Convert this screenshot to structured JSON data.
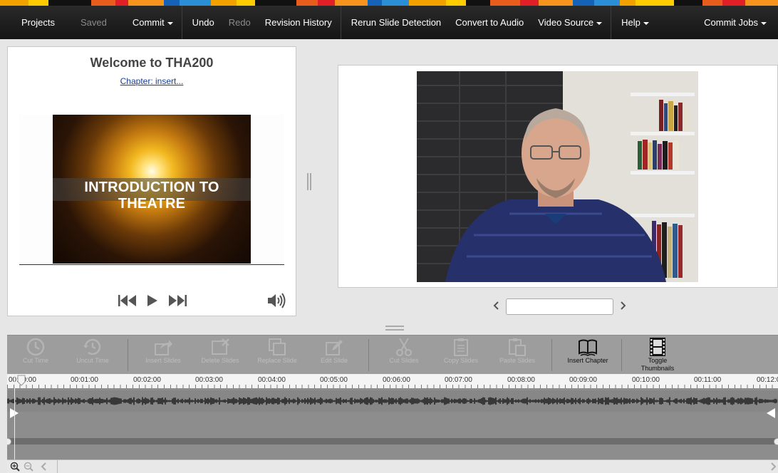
{
  "colors": {
    "navbar_bg": "#1c1c1c",
    "stripe": [
      "#f2a100",
      "#e85c1c",
      "#1463b8",
      "#ffcc00",
      "#e01f27",
      "#2a8fd6",
      "#111111",
      "#f7941d"
    ]
  },
  "navbar": {
    "items": [
      {
        "label": "Projects",
        "disabled": false,
        "caret": false
      },
      {
        "label": "Saved",
        "disabled": true,
        "caret": false
      },
      {
        "label": "Commit",
        "disabled": false,
        "caret": true
      },
      {
        "label": "Undo",
        "disabled": false,
        "caret": false
      },
      {
        "label": "Redo",
        "disabled": true,
        "caret": false
      },
      {
        "label": "Revision History",
        "disabled": false,
        "caret": false
      },
      {
        "label": "Rerun Slide Detection",
        "disabled": false,
        "caret": false
      },
      {
        "label": "Convert to Audio",
        "disabled": false,
        "caret": false
      },
      {
        "label": "Video Source",
        "disabled": false,
        "caret": true
      },
      {
        "label": "Help",
        "disabled": false,
        "caret": true
      },
      {
        "label": "Commit Jobs",
        "disabled": false,
        "caret": true
      }
    ]
  },
  "slide_panel": {
    "title": "Welcome to THA200",
    "chapter_link": "Chapter: insert...",
    "slide_text": "INTRODUCTION TO THEATRE",
    "controls": [
      "skip-back-icon",
      "play-icon",
      "skip-forward-icon",
      "volume-icon"
    ]
  },
  "video_panel": {
    "slide_input_value": ""
  },
  "toolbar": {
    "buttons": [
      {
        "label": "Cut Time",
        "icon": "clock-icon",
        "active": false
      },
      {
        "label": "Uncut Time",
        "icon": "undo-clock-icon",
        "active": false
      },
      {
        "label": "Insert Slides",
        "icon": "share-icon",
        "active": false
      },
      {
        "label": "Delete Slides",
        "icon": "delete-icon",
        "active": false
      },
      {
        "label": "Replace Slide",
        "icon": "copy-icon",
        "active": false
      },
      {
        "label": "Edit Slide",
        "icon": "edit-icon",
        "active": false
      },
      {
        "label": "Cut Slides",
        "icon": "scissors-icon",
        "active": false
      },
      {
        "label": "Copy Slides",
        "icon": "clipboard-icon",
        "active": false
      },
      {
        "label": "Paste Slides",
        "icon": "paste-icon",
        "active": false
      },
      {
        "label": "Insert Chapter",
        "icon": "book-icon",
        "active": true
      },
      {
        "label": "Toggle Thumbnails",
        "icon": "film-icon",
        "active": true
      }
    ]
  },
  "timeline": {
    "ticks": [
      "00:00:00",
      "00:01:00",
      "00:02:00",
      "00:03:00",
      "00:04:00",
      "00:05:00",
      "00:06:00",
      "00:07:00",
      "00:08:00",
      "00:09:00",
      "00:10:00",
      "00:11:00",
      "00:12:0"
    ]
  }
}
